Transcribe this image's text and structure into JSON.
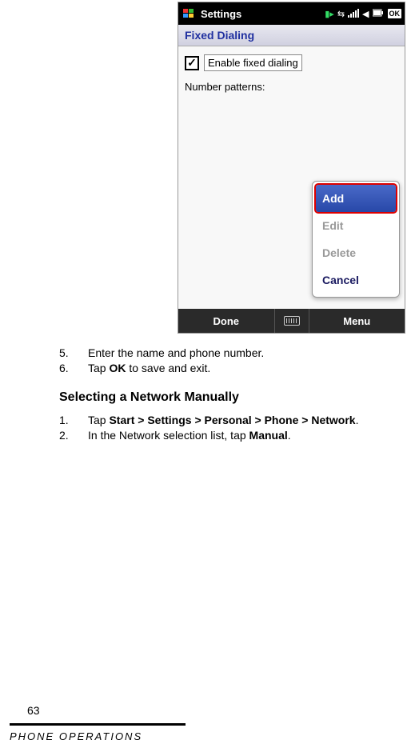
{
  "phone": {
    "statusbar": {
      "title": "Settings",
      "ok_label": "OK"
    },
    "app_header": "Fixed Dialing",
    "checkbox_label": "Enable fixed dialing",
    "section_label": "Number patterns:",
    "context_menu": {
      "add": "Add",
      "edit": "Edit",
      "delete": "Delete",
      "cancel": "Cancel"
    },
    "bottom_bar": {
      "done": "Done",
      "menu": "Menu"
    }
  },
  "doc": {
    "steps_a": {
      "item5_num": "5.",
      "item5_text": "Enter the name and phone number.",
      "item6_num": "6.",
      "item6_pre": "Tap ",
      "item6_bold": "OK",
      "item6_post": " to save and exit."
    },
    "subheading": "Selecting a Network Manually",
    "steps_b": {
      "item1_num": "1.",
      "item1_pre": "Tap ",
      "item1_bold": "Start > Settings > Personal > Phone > Network",
      "item1_post": ".",
      "item2_num": "2.",
      "item2_pre": "In the Network selection list, tap ",
      "item2_bold": "Manual",
      "item2_post": "."
    },
    "page_number": "63",
    "footer": "Phone  Operations"
  }
}
